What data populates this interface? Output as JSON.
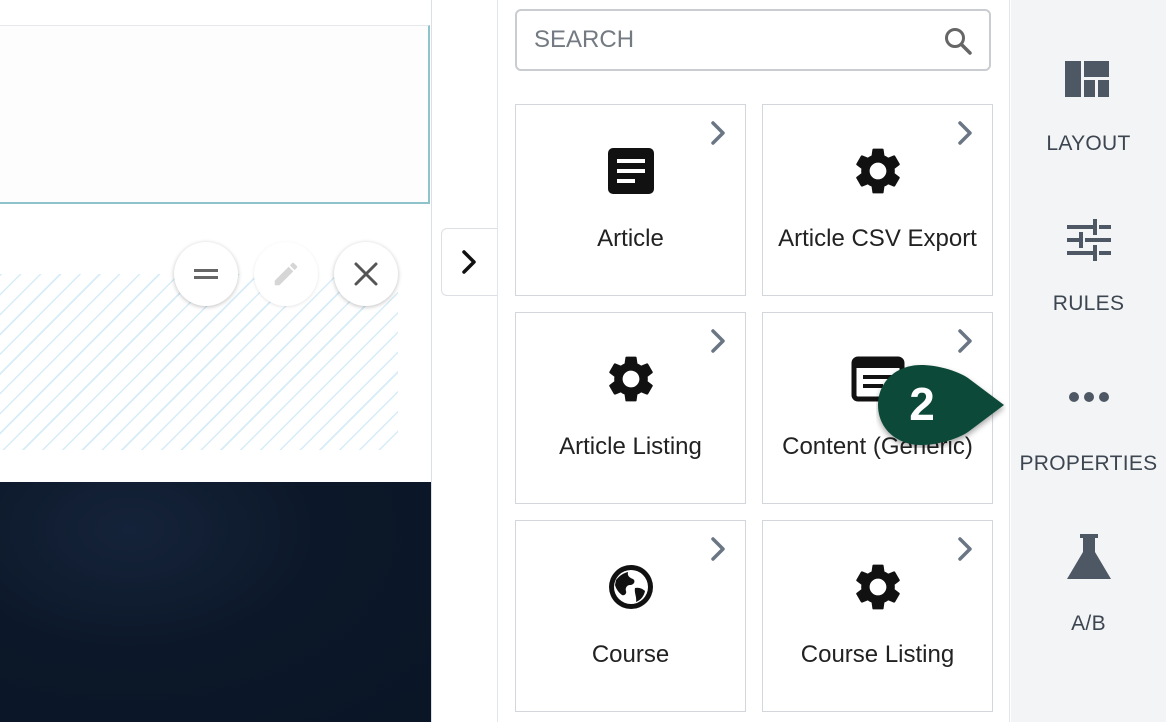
{
  "search": {
    "placeholder": "SEARCH"
  },
  "components": [
    {
      "label": "Article",
      "icon": "article-icon"
    },
    {
      "label": "Article CSV Export",
      "icon": "gear-icon"
    },
    {
      "label": "Article Listing",
      "icon": "gear-icon"
    },
    {
      "label": "Content (Generic)",
      "icon": "content-generic-icon"
    },
    {
      "label": "Course",
      "icon": "globe-icon"
    },
    {
      "label": "Course Listing",
      "icon": "gear-icon"
    }
  ],
  "sidebar": {
    "tabs": [
      {
        "label": "LAYOUT",
        "icon": "layout-icon"
      },
      {
        "label": "RULES",
        "icon": "sliders-icon"
      },
      {
        "label": "PROPERTIES",
        "icon": "more-horizontal-icon"
      },
      {
        "label": "A/B",
        "icon": "flask-icon"
      }
    ]
  },
  "canvas": {
    "controls": [
      "drag-handle-icon",
      "edit-pencil-icon",
      "close-icon"
    ]
  },
  "callout": {
    "number": "2",
    "color": "#0b4a38"
  },
  "colors": {
    "tile_border": "#d3d6da",
    "sidebar_bg": "#f3f4f6",
    "selected_outline": "#8fc3cc",
    "dark_section": "#0c1829"
  }
}
